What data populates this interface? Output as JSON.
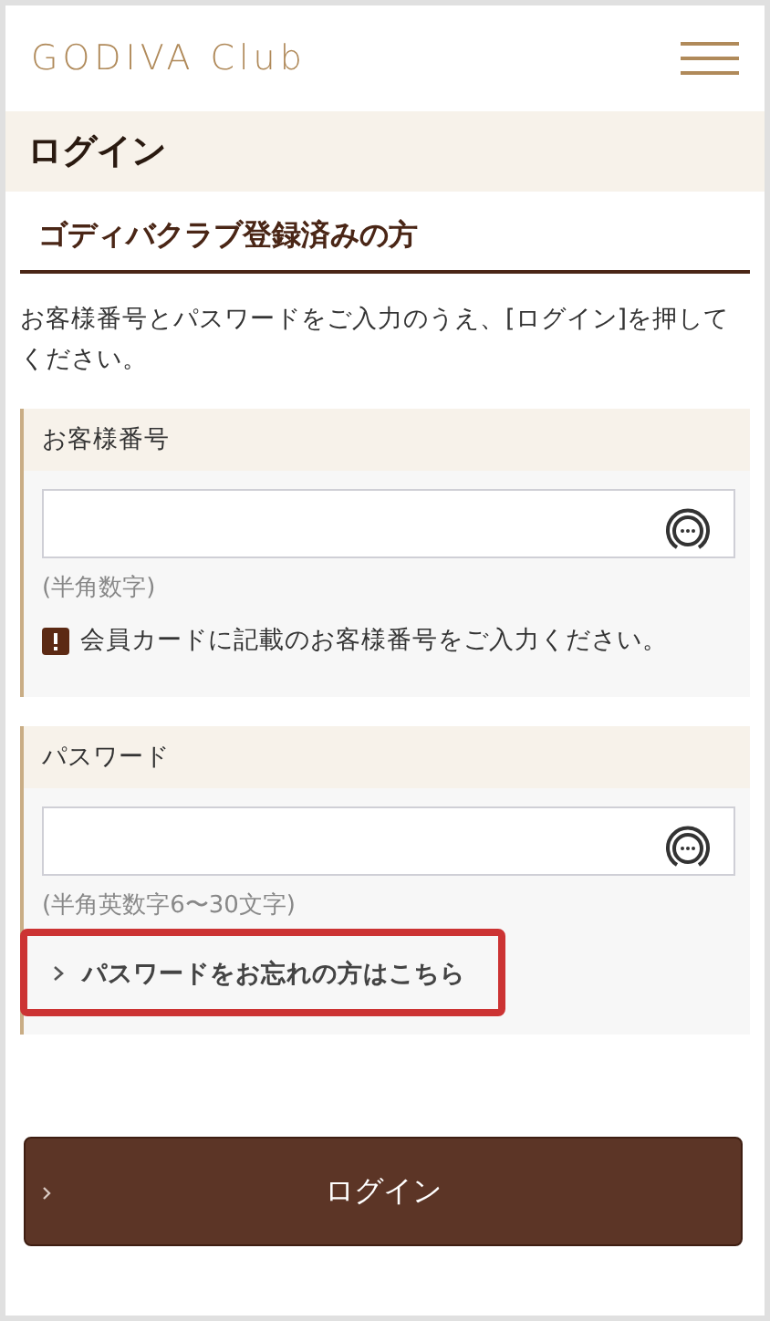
{
  "header": {
    "logo": "GODIVA Club"
  },
  "page_title": "ログイン",
  "section_heading": "ゴディバクラブ登録済みの方",
  "instructions": "お客様番号とパスワードをご入力のうえ、[ログイン]を押してください。",
  "fields": [
    {
      "label": "お客様番号",
      "hint": "(半角数字)",
      "error": "会員カードに記載のお客様番号をご入力ください。"
    },
    {
      "label": "パスワード",
      "hint": "(半角英数字6〜30文字)"
    }
  ],
  "forgot_link": {
    "label": "パスワードをお忘れの方はこちら",
    "highlighted": true
  },
  "submit_button": {
    "label": "ログイン"
  }
}
